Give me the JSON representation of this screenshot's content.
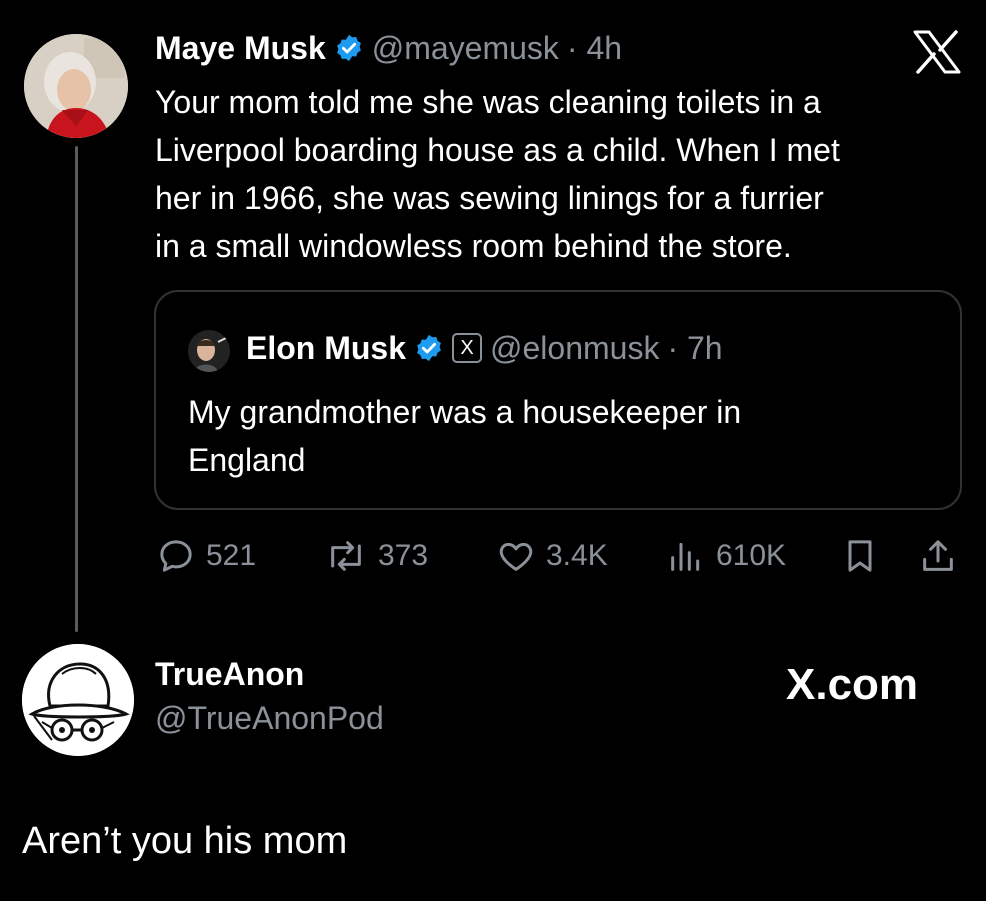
{
  "tweet": {
    "author_name": "Maye Musk",
    "handle": "@mayemusk",
    "time": "· 4h",
    "lines": [
      "Your mom told me she was cleaning toilets in a",
      "Liverpool boarding house as a child. When I met",
      "her in 1966, she was sewing linings for a furrier",
      "in a small windowless room behind the store."
    ],
    "quote": {
      "author_name": "Elon Musk",
      "handle": "@elonmusk",
      "time": "· 7h",
      "x_badge": "X",
      "lines": [
        "My grandmother was a housekeeper in",
        "England"
      ]
    },
    "actions": {
      "replies": "521",
      "reposts": "373",
      "likes": "3.4K",
      "views": "610K"
    },
    "icons": {
      "verified": "verified-badge-icon",
      "x_logo": "x-logo-icon"
    },
    "colors": {
      "background": "#000000",
      "verified": "#1d9bf0",
      "muted": "#8b9198"
    }
  },
  "reply": {
    "author_name": "TrueAnon",
    "handle": "@TrueAnonPod",
    "watermark": "X.com",
    "text": "Aren’t you his mom"
  }
}
